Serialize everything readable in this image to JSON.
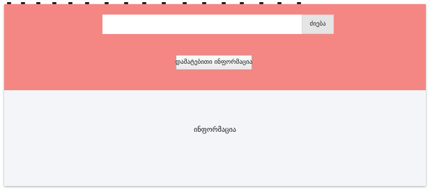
{
  "search": {
    "value": "",
    "placeholder": "",
    "button_label": "ძიება"
  },
  "actions": {
    "additional_info_label": "დამატებითი ინფორმაცია"
  },
  "content": {
    "info_text": "ინფორმაცია"
  },
  "colors": {
    "hero_background": "#f48784",
    "content_background": "#f3f5f9",
    "search_button_background": "#e5e5e5"
  }
}
